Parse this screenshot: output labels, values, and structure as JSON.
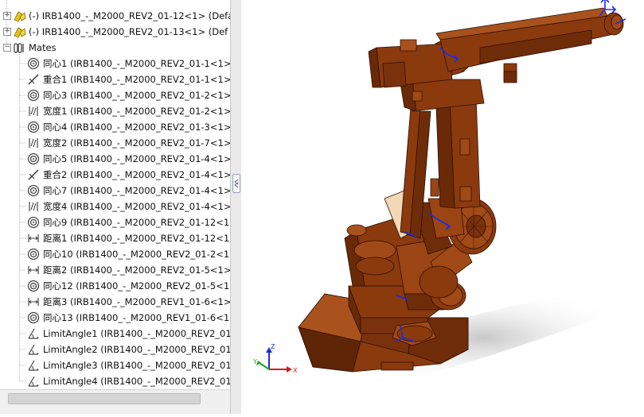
{
  "feature_tree": {
    "components": [
      {
        "label": "(-) IRB1400_-_M2000_REV2_01-12<1> (Defa"
      },
      {
        "label": "(-) IRB1400_-_M2000_REV2_01-13<1> (Def"
      }
    ],
    "mates_folder_label": "Mates",
    "mates": [
      {
        "type": "concentric",
        "icon": "concentric-mate-icon",
        "label": "同心1 (IRB1400_-_M2000_REV2_01-1<1>"
      },
      {
        "type": "coincident",
        "icon": "coincident-mate-icon",
        "label": "重合1 (IRB1400_-_M2000_REV2_01-1<1>"
      },
      {
        "type": "concentric",
        "icon": "concentric-mate-icon",
        "label": "同心3 (IRB1400_-_M2000_REV2_01-2<1>"
      },
      {
        "type": "width",
        "icon": "width-mate-icon",
        "label": "宽度1 (IRB1400_-_M2000_REV2_01-2<1>"
      },
      {
        "type": "concentric",
        "icon": "concentric-mate-icon",
        "label": "同心4 (IRB1400_-_M2000_REV2_01-3<1>"
      },
      {
        "type": "width",
        "icon": "width-mate-icon",
        "label": "宽度2 (IRB1400_-_M2000_REV2_01-7<1>"
      },
      {
        "type": "concentric",
        "icon": "concentric-mate-icon",
        "label": "同心5 (IRB1400_-_M2000_REV2_01-4<1>"
      },
      {
        "type": "coincident",
        "icon": "coincident-mate-icon",
        "label": "重合2 (IRB1400_-_M2000_REV2_01-4<1>"
      },
      {
        "type": "concentric",
        "icon": "concentric-mate-icon",
        "label": "同心7 (IRB1400_-_M2000_REV2_01-4<1>"
      },
      {
        "type": "width",
        "icon": "width-mate-icon",
        "label": "宽度4 (IRB1400_-_M2000_REV2_01-4<1>"
      },
      {
        "type": "concentric",
        "icon": "concentric-mate-icon",
        "label": "同心9 (IRB1400_-_M2000_REV2_01-12<1"
      },
      {
        "type": "distance",
        "icon": "distance-mate-icon",
        "label": "距离1 (IRB1400_-_M2000_REV2_01-12<1"
      },
      {
        "type": "concentric",
        "icon": "concentric-mate-icon",
        "label": "同心10 (IRB1400_-_M2000_REV2_01-2<1"
      },
      {
        "type": "distance",
        "icon": "distance-mate-icon",
        "label": "距离2 (IRB1400_-_M2000_REV2_01-5<1>"
      },
      {
        "type": "concentric",
        "icon": "concentric-mate-icon",
        "label": "同心12 (IRB1400_-_M2000_REV2_01-5<1"
      },
      {
        "type": "distance",
        "icon": "distance-mate-icon",
        "label": "距离3 (IRB1400_-_M2000_REV1_01-6<1>"
      },
      {
        "type": "concentric",
        "icon": "concentric-mate-icon",
        "label": "同心13 (IRB1400_-_M2000_REV1_01-6<1"
      },
      {
        "type": "limit-angle",
        "icon": "limit-angle-mate-icon",
        "label": "LimitAngle1 (IRB1400_-_M2000_REV2_01"
      },
      {
        "type": "limit-angle",
        "icon": "limit-angle-mate-icon",
        "label": "LimitAngle2 (IRB1400_-_M2000_REV2_01"
      },
      {
        "type": "limit-angle",
        "icon": "limit-angle-mate-icon",
        "label": "LimitAngle3 (IRB1400_-_M2000_REV2_01"
      },
      {
        "type": "limit-angle",
        "icon": "limit-angle-mate-icon",
        "label": "LimitAngle4 (IRB1400_-_M2000_REV2_01"
      }
    ]
  },
  "viewport": {
    "model_color": "#8b3a0e",
    "triad": {
      "x_label": "X",
      "y_label": "Y",
      "z_label": "Z"
    }
  },
  "colors": {
    "axis_x": "#d11c1c",
    "axis_y": "#1aa61a",
    "axis_z": "#1c2fd6",
    "component_icon": "#e7c21c",
    "manipulator": "#1a2ee0"
  }
}
